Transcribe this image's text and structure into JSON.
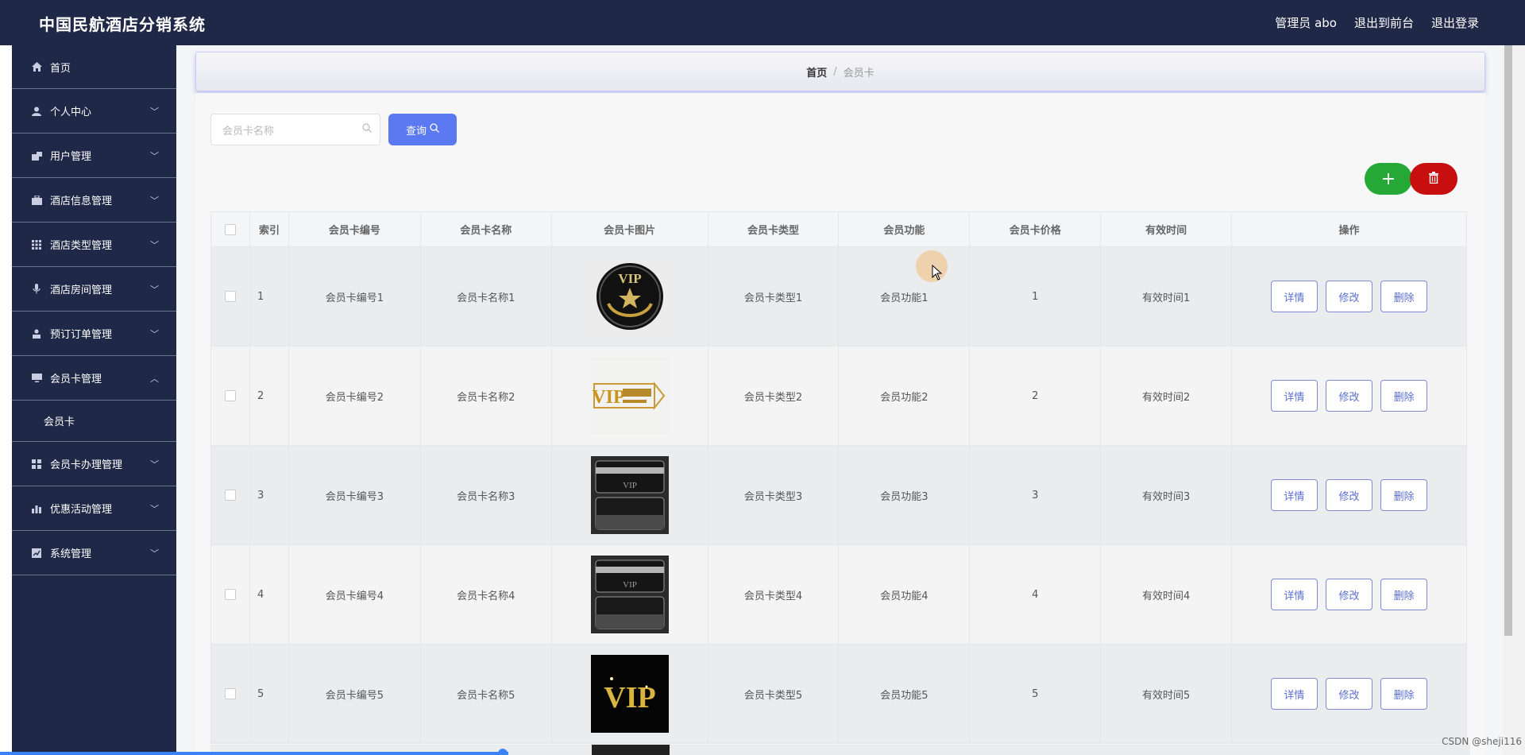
{
  "app": {
    "title": "中国民航酒店分销系统",
    "user_label": "管理员 abo",
    "to_front_label": "退出到前台",
    "logout_label": "退出登录"
  },
  "sidebar": {
    "home": {
      "label": "首页",
      "icon": "home-icon"
    },
    "items": [
      {
        "label": "个人中心",
        "icon": "user-icon"
      },
      {
        "label": "用户管理",
        "icon": "user-manage-icon"
      },
      {
        "label": "酒店信息管理",
        "icon": "briefcase-icon"
      },
      {
        "label": "酒店类型管理",
        "icon": "grid-icon"
      },
      {
        "label": "酒店房间管理",
        "icon": "mic-icon"
      },
      {
        "label": "预订订单管理",
        "icon": "person-icon"
      },
      {
        "label": "会员卡管理",
        "icon": "monitor-icon",
        "expanded": true,
        "children": [
          {
            "label": "会员卡"
          }
        ]
      },
      {
        "label": "会员卡办理管理",
        "icon": "apps-icon"
      },
      {
        "label": "优惠活动管理",
        "icon": "chart-icon"
      },
      {
        "label": "系统管理",
        "icon": "settings-icon"
      }
    ]
  },
  "breadcrumb": {
    "home": "首页",
    "separator": "/",
    "current": "会员卡"
  },
  "search": {
    "placeholder": "会员卡名称",
    "button_label": "查询"
  },
  "colors": {
    "nav": "#1f2847",
    "primary": "#5b79f0",
    "add": "#25a836",
    "delete": "#c80f0f"
  },
  "table": {
    "headers": [
      "索引",
      "会员卡编号",
      "会员卡名称",
      "会员卡图片",
      "会员卡类型",
      "会员功能",
      "会员卡价格",
      "有效时间",
      "操作"
    ],
    "actions": {
      "detail": "详情",
      "edit": "修改",
      "delete": "删除"
    },
    "rows": [
      {
        "idx": "1",
        "code": "会员卡编号1",
        "name": "会员卡名称1",
        "img_text": "VIP",
        "type": "会员卡类型1",
        "func": "会员功能1",
        "price": "1",
        "valid": "有效时间1"
      },
      {
        "idx": "2",
        "code": "会员卡编号2",
        "name": "会员卡名称2",
        "img_text": "VIP",
        "type": "会员卡类型2",
        "func": "会员功能2",
        "price": "2",
        "valid": "有效时间2"
      },
      {
        "idx": "3",
        "code": "会员卡编号3",
        "name": "会员卡名称3",
        "img_text": "VIP",
        "type": "会员卡类型3",
        "func": "会员功能3",
        "price": "3",
        "valid": "有效时间3"
      },
      {
        "idx": "4",
        "code": "会员卡编号4",
        "name": "会员卡名称4",
        "img_text": "VIP",
        "type": "会员卡类型4",
        "func": "会员功能4",
        "price": "4",
        "valid": "有效时间4"
      },
      {
        "idx": "5",
        "code": "会员卡编号5",
        "name": "会员卡名称5",
        "img_text": "VIP",
        "type": "会员卡类型5",
        "func": "会员功能5",
        "price": "5",
        "valid": "有效时间5"
      }
    ]
  },
  "watermark": "CSDN @sheji116"
}
